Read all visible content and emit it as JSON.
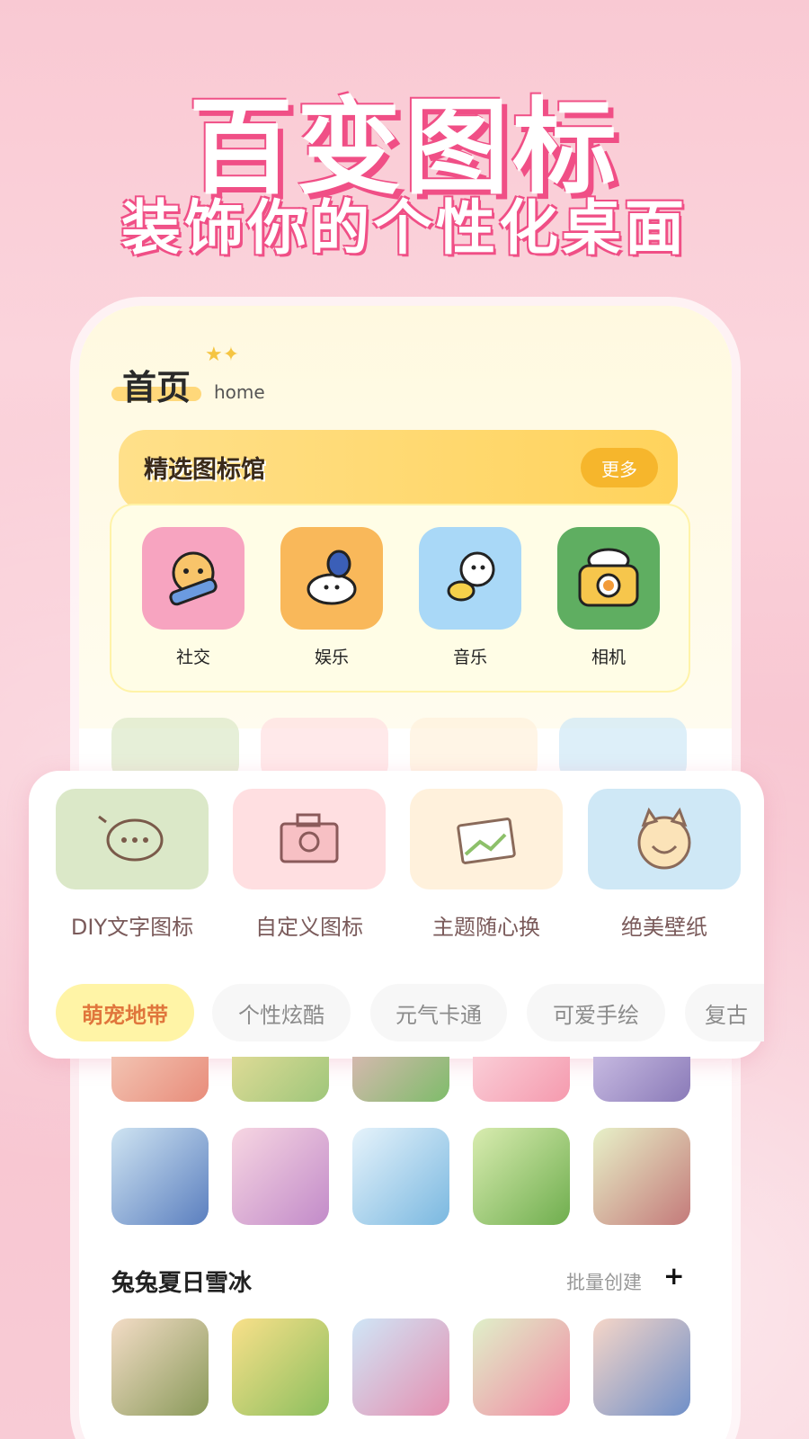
{
  "promo": {
    "headline": "百变图标",
    "subline": "装饰你的个性化桌面"
  },
  "header": {
    "title": "首页",
    "subtitle": "home"
  },
  "featured": {
    "title": "精选图标馆",
    "more_label": "更多",
    "icons": [
      {
        "label": "社交",
        "color": "#f7a4c0",
        "icon": "tiger-pencil-icon"
      },
      {
        "label": "娱乐",
        "color": "#f9b85a",
        "icon": "bunny-icon"
      },
      {
        "label": "音乐",
        "color": "#a9d8f7",
        "icon": "dog-duck-icon"
      },
      {
        "label": "相机",
        "color": "#5fae61",
        "icon": "camera-icon"
      }
    ]
  },
  "tools": [
    {
      "label": "DIY文字图标",
      "color": "#dbe8c8",
      "icon": "chat-bubble-icon"
    },
    {
      "label": "自定义图标",
      "color": "#ffdfe1",
      "icon": "camera-outline-icon"
    },
    {
      "label": "主题随心换",
      "color": "#fff1dc",
      "icon": "picture-icon"
    },
    {
      "label": "绝美壁纸",
      "color": "#cfe8f6",
      "icon": "cat-face-icon"
    }
  ],
  "chips": [
    {
      "label": "萌宠地带",
      "active": true
    },
    {
      "label": "个性炫酷",
      "active": false
    },
    {
      "label": "元气卡通",
      "active": false
    },
    {
      "label": "可爱手绘",
      "active": false
    },
    {
      "label": "复古",
      "active": false
    }
  ],
  "section": {
    "title": "兔兔夏日雪冰",
    "batch_label": "批量创建",
    "add_symbol": "+"
  }
}
